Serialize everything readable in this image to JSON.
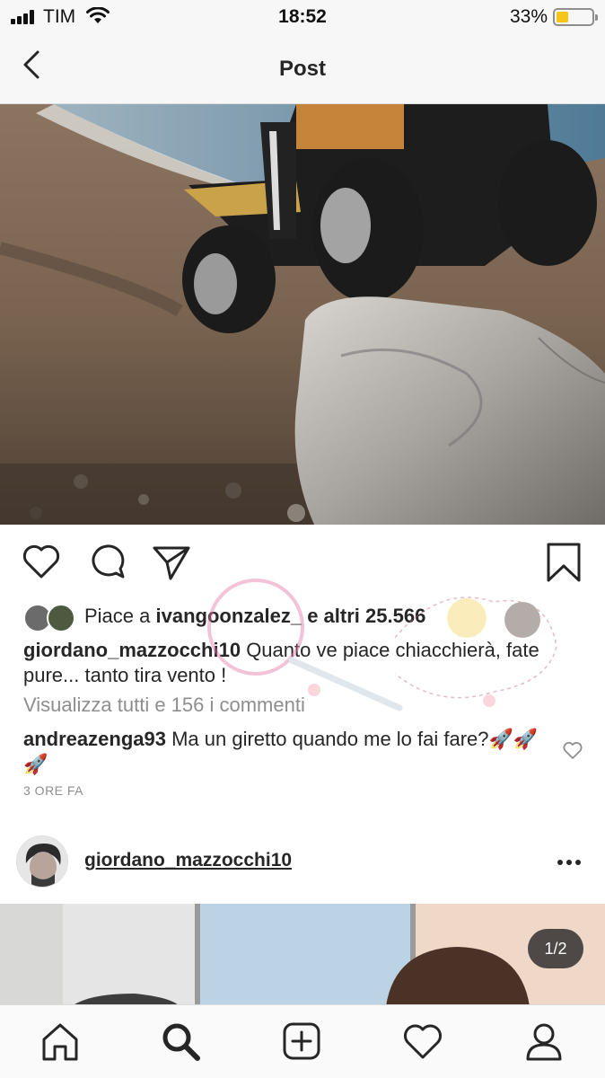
{
  "status_bar": {
    "carrier": "TIM",
    "time": "18:52",
    "battery_percent": "33%",
    "battery_level": 0.33,
    "icons": [
      "signal-icon",
      "wifi-icon",
      "battery-icon"
    ]
  },
  "nav": {
    "title": "Post",
    "back_icon": "chevron-left-icon"
  },
  "post": {
    "actions": [
      "heart-icon",
      "comment-icon",
      "share-icon",
      "bookmark-icon"
    ],
    "likes_prefix": "Piace a ",
    "likes_user": "ivangoonzalez_",
    "likes_suffix": " e altri 25.566",
    "caption_user": "giordano_mazzocchi10",
    "caption_text": " Quanto ve piace chiacchierà, fate pure... tanto tira vento !",
    "view_all": "Visualizza tutti e 156 i commenti",
    "comment_user": "andreazenga93",
    "comment_text": " Ma un giretto quando me lo fai fare?🚀🚀🚀",
    "time_ago": "3 ORE FA"
  },
  "next_post": {
    "username": "giordano_mazzocchi10",
    "more_icon": "more-icon",
    "page_indicator": "1/2"
  },
  "tab_bar": {
    "tabs": [
      "home-icon",
      "search-icon",
      "add-icon",
      "activity-heart-icon",
      "profile-icon"
    ]
  },
  "colors": {
    "text": "#262626",
    "secondary": "#8e8e8e",
    "battery_fill": "#f5c518"
  }
}
